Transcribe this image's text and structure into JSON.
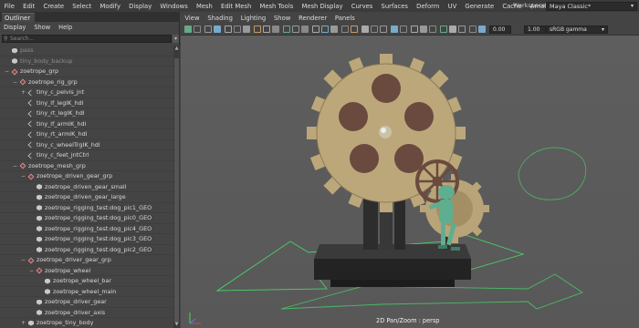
{
  "main_menu": [
    "File",
    "Edit",
    "Create",
    "Select",
    "Modify",
    "Display",
    "Windows",
    "Mesh",
    "Edit Mesh",
    "Mesh Tools",
    "Mesh Display",
    "Curves",
    "Surfaces",
    "Deform",
    "UV",
    "Generate",
    "Cache",
    "Arnold",
    "Help"
  ],
  "workspace": {
    "label": "Workspace :",
    "value": "Maya Classic*"
  },
  "outliner": {
    "tab": "Outliner",
    "menu": [
      "Display",
      "Show",
      "Help"
    ],
    "search_placeholder": "Search...",
    "items": [
      {
        "label": "pass",
        "indent": 0,
        "icon": "mesh",
        "dim": true,
        "expander": ""
      },
      {
        "label": "tiny_body_backup",
        "indent": 0,
        "icon": "mesh",
        "dim": true,
        "expander": ""
      },
      {
        "label": "zoetrope_grp",
        "indent": 0,
        "icon": "group",
        "dim": false,
        "expander": "−"
      },
      {
        "label": "zoetrope_rig_grp",
        "indent": 1,
        "icon": "group",
        "dim": false,
        "expander": "−"
      },
      {
        "label": "tiny_c_pelvis_jnt",
        "indent": 2,
        "icon": "control",
        "dim": false,
        "expander": "+"
      },
      {
        "label": "tiny_lf_legIK_hdl",
        "indent": 2,
        "icon": "control",
        "dim": false,
        "expander": ""
      },
      {
        "label": "tiny_rt_legIK_hdl",
        "indent": 2,
        "icon": "control",
        "dim": false,
        "expander": ""
      },
      {
        "label": "tiny_lf_armIK_hdl",
        "indent": 2,
        "icon": "control",
        "dim": false,
        "expander": ""
      },
      {
        "label": "tiny_rt_armIK_hdl",
        "indent": 2,
        "icon": "control",
        "dim": false,
        "expander": ""
      },
      {
        "label": "tiny_c_wheelTrgIK_hdl",
        "indent": 2,
        "icon": "control",
        "dim": false,
        "expander": ""
      },
      {
        "label": "tiny_c_feet_jntCtrl",
        "indent": 2,
        "icon": "control",
        "dim": false,
        "expander": ""
      },
      {
        "label": "zoetrope_mesh_grp",
        "indent": 1,
        "icon": "group",
        "dim": false,
        "expander": "−"
      },
      {
        "label": "zoetrope_driven_gear_grp",
        "indent": 2,
        "icon": "group",
        "dim": false,
        "expander": "−"
      },
      {
        "label": "zoetrope_driven_gear_small",
        "indent": 3,
        "icon": "mesh",
        "dim": false,
        "expander": ""
      },
      {
        "label": "zoetrope_driven_gear_large",
        "indent": 3,
        "icon": "mesh",
        "dim": false,
        "expander": ""
      },
      {
        "label": "zoetrope_rigging_test:dog_pic1_GEO",
        "indent": 3,
        "icon": "mesh",
        "dim": false,
        "expander": ""
      },
      {
        "label": "zoetrope_rigging_test:dog_pic0_GEO",
        "indent": 3,
        "icon": "mesh",
        "dim": false,
        "expander": ""
      },
      {
        "label": "zoetrope_rigging_test:dog_pic4_GEO",
        "indent": 3,
        "icon": "mesh",
        "dim": false,
        "expander": ""
      },
      {
        "label": "zoetrope_rigging_test:dog_pic3_GEO",
        "indent": 3,
        "icon": "mesh",
        "dim": false,
        "expander": ""
      },
      {
        "label": "zoetrope_rigging_test:dog_pic2_GEO",
        "indent": 3,
        "icon": "mesh",
        "dim": false,
        "expander": ""
      },
      {
        "label": "zoetrope_driver_gear_grp",
        "indent": 2,
        "icon": "group",
        "dim": false,
        "expander": "−"
      },
      {
        "label": "zoetrope_wheel",
        "indent": 3,
        "icon": "group",
        "dim": false,
        "expander": "−"
      },
      {
        "label": "zoetrope_wheel_bar",
        "indent": 4,
        "icon": "mesh",
        "dim": false,
        "expander": ""
      },
      {
        "label": "zoetrope_wheel_main",
        "indent": 4,
        "icon": "mesh",
        "dim": false,
        "expander": ""
      },
      {
        "label": "zoetrope_driver_gear",
        "indent": 3,
        "icon": "mesh",
        "dim": false,
        "expander": ""
      },
      {
        "label": "zoetrope_driver_axis",
        "indent": 3,
        "icon": "mesh",
        "dim": false,
        "expander": ""
      },
      {
        "label": "zoetrope_tiny_body",
        "indent": 2,
        "icon": "mesh",
        "dim": false,
        "expander": "+"
      }
    ]
  },
  "viewport": {
    "menu": [
      "View",
      "Shading",
      "Lighting",
      "Show",
      "Renderer",
      "Panels"
    ],
    "exposure": "0.00",
    "gamma": "1.00",
    "color_space": "sRGB gamma",
    "caption": "2D Pan/Zoom : persp"
  },
  "colors": {
    "gear": "#bca77b",
    "gear_dark": "#8c7a55",
    "hole": "#6a4a3e",
    "base": "#2e2e2e",
    "arrow": "#49d26a",
    "figure": "#5fae90"
  }
}
